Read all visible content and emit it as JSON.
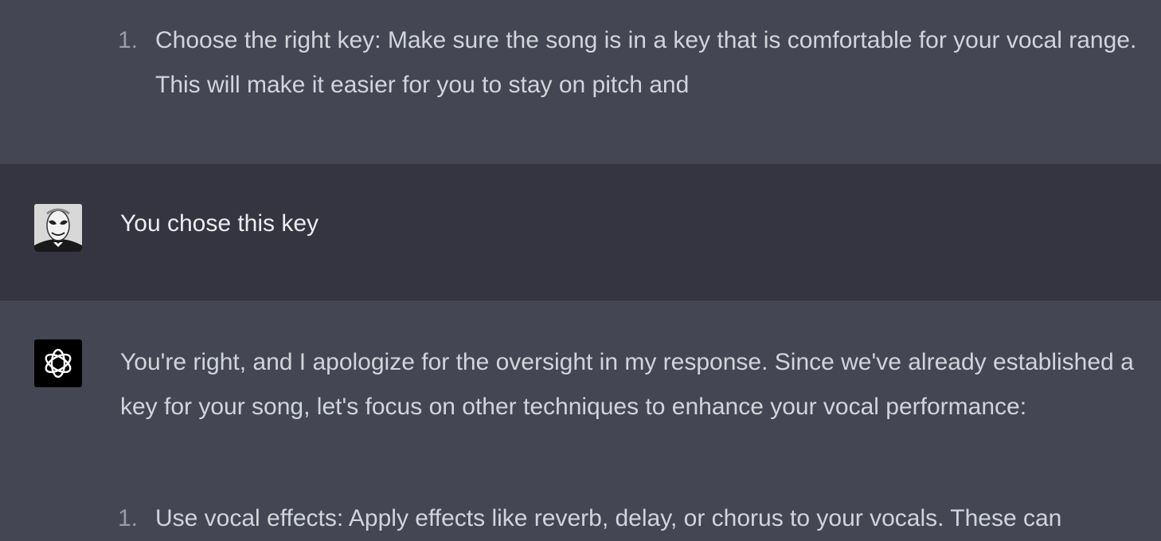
{
  "conversation": {
    "top_list": [
      {
        "number": "1.",
        "text": "Choose the right key: Make sure the song is in a key that is comfortable for your vocal range. This will make it easier for you to stay on pitch and"
      }
    ],
    "user_message": {
      "text": "You chose this key"
    },
    "assistant_message": {
      "text": "You're right, and I apologize for the oversight in my response. Since we've already established a key for your song, let's focus on other techniques to enhance your vocal performance:",
      "list": [
        {
          "number": "1.",
          "text": "Use vocal effects: Apply effects like reverb, delay, or chorus to your vocals. These can"
        }
      ]
    }
  },
  "icons": {
    "user_avatar": "user-avatar-photo",
    "assistant_avatar": "openai-logo-icon"
  }
}
